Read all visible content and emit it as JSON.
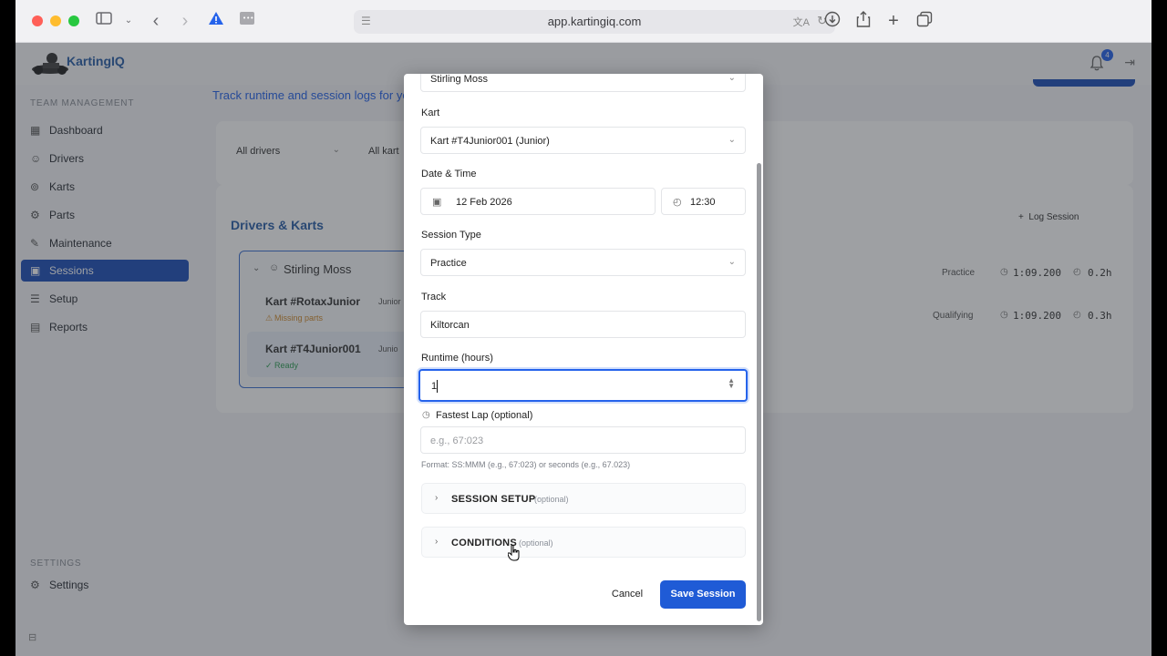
{
  "browser": {
    "url": "app.kartingiq.com"
  },
  "app": {
    "name": "KartingIQ",
    "notification_count": "4",
    "subtitle": "Track runtime and session logs for yo"
  },
  "sidebar": {
    "section_team": "TEAM MANAGEMENT",
    "items": [
      {
        "label": "Dashboard",
        "icon": "dashboard-icon"
      },
      {
        "label": "Drivers",
        "icon": "users-icon"
      },
      {
        "label": "Karts",
        "icon": "kart-icon"
      },
      {
        "label": "Parts",
        "icon": "parts-icon"
      },
      {
        "label": "Maintenance",
        "icon": "wrench-icon"
      },
      {
        "label": "Sessions",
        "icon": "calendar-icon"
      },
      {
        "label": "Setup",
        "icon": "sliders-icon"
      },
      {
        "label": "Reports",
        "icon": "report-icon"
      }
    ],
    "section_settings": "SETTINGS",
    "settings_item": "Settings"
  },
  "filters": {
    "drivers": "All drivers",
    "karts": "All kart"
  },
  "panel": {
    "title": "Drivers & Karts",
    "log_session": "Log Session",
    "driver": "Stirling Moss",
    "karts": [
      {
        "name": "Kart #RotaxJunior",
        "tag": "Junior",
        "status": "Missing parts"
      },
      {
        "name": "Kart #T4Junior001",
        "tag": "Junio",
        "status": "Ready"
      }
    ],
    "sessions": [
      {
        "type": "Practice",
        "lap": "1:09.200",
        "runtime": "0.2h"
      },
      {
        "type": "Qualifying",
        "lap": "1:09.200",
        "runtime": "0.3h"
      }
    ]
  },
  "modal": {
    "driver_value": "Stirling Moss",
    "kart_label": "Kart",
    "kart_value": "Kart #T4Junior001 (Junior)",
    "datetime_label": "Date & Time",
    "date_value": "12 Feb 2026",
    "time_value": "12:30",
    "session_type_label": "Session Type",
    "session_type_value": "Practice",
    "track_label": "Track",
    "track_value": "Kiltorcan",
    "runtime_label": "Runtime (hours)",
    "runtime_value": "1",
    "fastest_lap_label": "Fastest Lap (optional)",
    "fastest_lap_placeholder": "e.g., 67:023",
    "format_hint": "Format: SS:MMM (e.g., 67:023) or seconds (e.g., 67.023)",
    "session_setup_label": "SESSION SETUP",
    "conditions_label": "CONDITIONS",
    "optional_label": "(optional)",
    "cancel_label": "Cancel",
    "save_label": "Save Session"
  },
  "colors": {
    "accent": "#1f5bd6",
    "sidebar_active": "#1e4fb8"
  }
}
